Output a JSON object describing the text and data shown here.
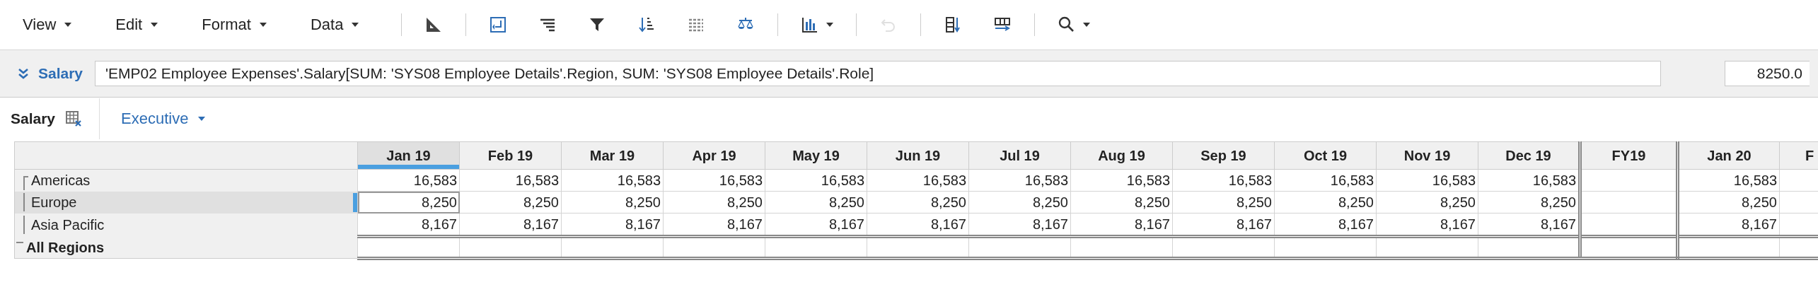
{
  "toolbar": {
    "menus": [
      {
        "label": "View"
      },
      {
        "label": "Edit"
      },
      {
        "label": "Format"
      },
      {
        "label": "Data"
      }
    ],
    "tools": [
      {
        "kind": "separator"
      },
      {
        "kind": "ruler",
        "disabled": false
      },
      {
        "kind": "separator"
      },
      {
        "kind": "pivot",
        "disabled": false
      },
      {
        "kind": "indent",
        "disabled": false
      },
      {
        "kind": "filter",
        "disabled": false
      },
      {
        "kind": "sort",
        "disabled": false
      },
      {
        "kind": "grid",
        "disabled": false
      },
      {
        "kind": "scale",
        "disabled": false
      },
      {
        "kind": "separator"
      },
      {
        "kind": "chart",
        "disabled": false,
        "dropdown": true
      },
      {
        "kind": "separator"
      },
      {
        "kind": "undo",
        "disabled": true
      },
      {
        "kind": "separator"
      },
      {
        "kind": "insert-column",
        "disabled": false
      },
      {
        "kind": "insert-row",
        "disabled": false
      },
      {
        "kind": "separator"
      },
      {
        "kind": "search",
        "disabled": false,
        "dropdown": true
      }
    ]
  },
  "formula_bar": {
    "label": "Salary",
    "formula": "'EMP02 Employee Expenses'.Salary[SUM: 'SYS08 Employee Details'.Region, SUM: 'SYS08 Employee Details'.Role]",
    "value": "8250.0"
  },
  "view_header": {
    "title": "Salary",
    "filter": "Executive"
  },
  "grid": {
    "columns": [
      {
        "label": "Jan 19",
        "kind": "month",
        "selected": true
      },
      {
        "label": "Feb 19",
        "kind": "month",
        "selected": false
      },
      {
        "label": "Mar 19",
        "kind": "month",
        "selected": false
      },
      {
        "label": "Apr 19",
        "kind": "month",
        "selected": false
      },
      {
        "label": "May 19",
        "kind": "month",
        "selected": false
      },
      {
        "label": "Jun 19",
        "kind": "month",
        "selected": false
      },
      {
        "label": "Jul 19",
        "kind": "month",
        "selected": false
      },
      {
        "label": "Aug 19",
        "kind": "month",
        "selected": false
      },
      {
        "label": "Sep 19",
        "kind": "month",
        "selected": false
      },
      {
        "label": "Oct 19",
        "kind": "month",
        "selected": false
      },
      {
        "label": "Nov 19",
        "kind": "month",
        "selected": false
      },
      {
        "label": "Dec 19",
        "kind": "month",
        "selected": false
      },
      {
        "label": "FY19",
        "kind": "total",
        "selected": false
      },
      {
        "label": "Jan 20",
        "kind": "month",
        "selected": false
      },
      {
        "label": "F",
        "kind": "partial",
        "selected": false
      }
    ],
    "rows": [
      {
        "label": "Americas",
        "kind": "first",
        "selected": false,
        "values": [
          "16,583",
          "16,583",
          "16,583",
          "16,583",
          "16,583",
          "16,583",
          "16,583",
          "16,583",
          "16,583",
          "16,583",
          "16,583",
          "16,583",
          "16,583"
        ]
      },
      {
        "label": "Europe",
        "kind": "middle",
        "selected": true,
        "values": [
          "8,250",
          "8,250",
          "8,250",
          "8,250",
          "8,250",
          "8,250",
          "8,250",
          "8,250",
          "8,250",
          "8,250",
          "8,250",
          "8,250",
          "8,250"
        ]
      },
      {
        "label": "Asia Pacific",
        "kind": "middle",
        "selected": false,
        "values": [
          "8,167",
          "8,167",
          "8,167",
          "8,167",
          "8,167",
          "8,167",
          "8,167",
          "8,167",
          "8,167",
          "8,167",
          "8,167",
          "8,167",
          "8,167"
        ]
      },
      {
        "label": "All Regions",
        "kind": "total",
        "selected": false
      }
    ]
  }
}
